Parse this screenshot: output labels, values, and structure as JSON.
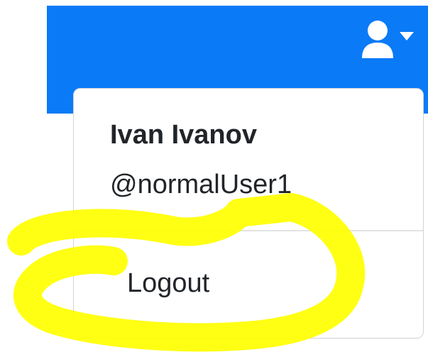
{
  "header": {
    "user_menu_icon": "user-icon",
    "caret_icon": "caret-down-icon",
    "brand_color": "#0a7af7"
  },
  "dropdown": {
    "name": "Ivan Ivanov",
    "username": "@normalUser1",
    "items": [
      {
        "label": "Logout"
      }
    ]
  },
  "annotation": {
    "highlight_color": "#ffff00"
  }
}
